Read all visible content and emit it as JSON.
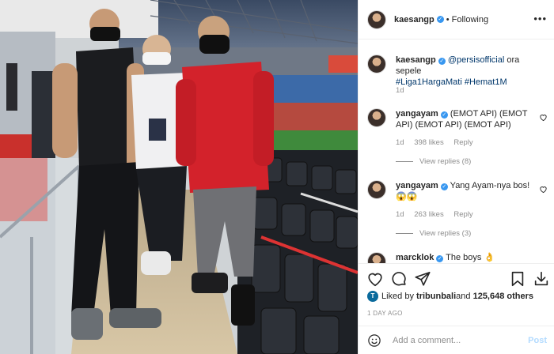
{
  "post": {
    "author": "kaesangp",
    "follow_state": "Following",
    "more_icon": "more-horizontal-icon"
  },
  "caption": {
    "username": "kaesangp",
    "mention": "@persisofficial",
    "text": " ora sepele",
    "hashtags": "#Liga1HargaMati #Hemat1M",
    "time": "1d"
  },
  "comments": [
    {
      "username": "yangayam",
      "text": "(EMOT API) (EMOT API) (EMOT API) (EMOT API)",
      "time": "1d",
      "likes": "398 likes",
      "reply": "Reply",
      "view_replies": "View replies (8)"
    },
    {
      "username": "yangayam",
      "text": "Yang Ayam-nya bos!😱😱",
      "time": "1d",
      "likes": "263 likes",
      "reply": "Reply",
      "view_replies": "View replies (3)"
    },
    {
      "username": "marcklok",
      "text": "The boys 👌"
    }
  ],
  "actions": {
    "like_icon": "heart-icon",
    "comment_icon": "comment-icon",
    "share_icon": "send-icon",
    "save_icon": "bookmark-icon",
    "download_icon": "download-icon"
  },
  "likes": {
    "prefix": "Liked by ",
    "first_liker": "tribunbali",
    "middle": " and ",
    "others": "125,648 others"
  },
  "time_ago": "1 DAY AGO",
  "add_comment": {
    "placeholder": "Add a comment...",
    "post_label": "Post"
  },
  "colors": {
    "link": "#00376b",
    "verified": "#3897f0",
    "muted": "#8e8e8e",
    "post_button": "#b3dbff"
  }
}
